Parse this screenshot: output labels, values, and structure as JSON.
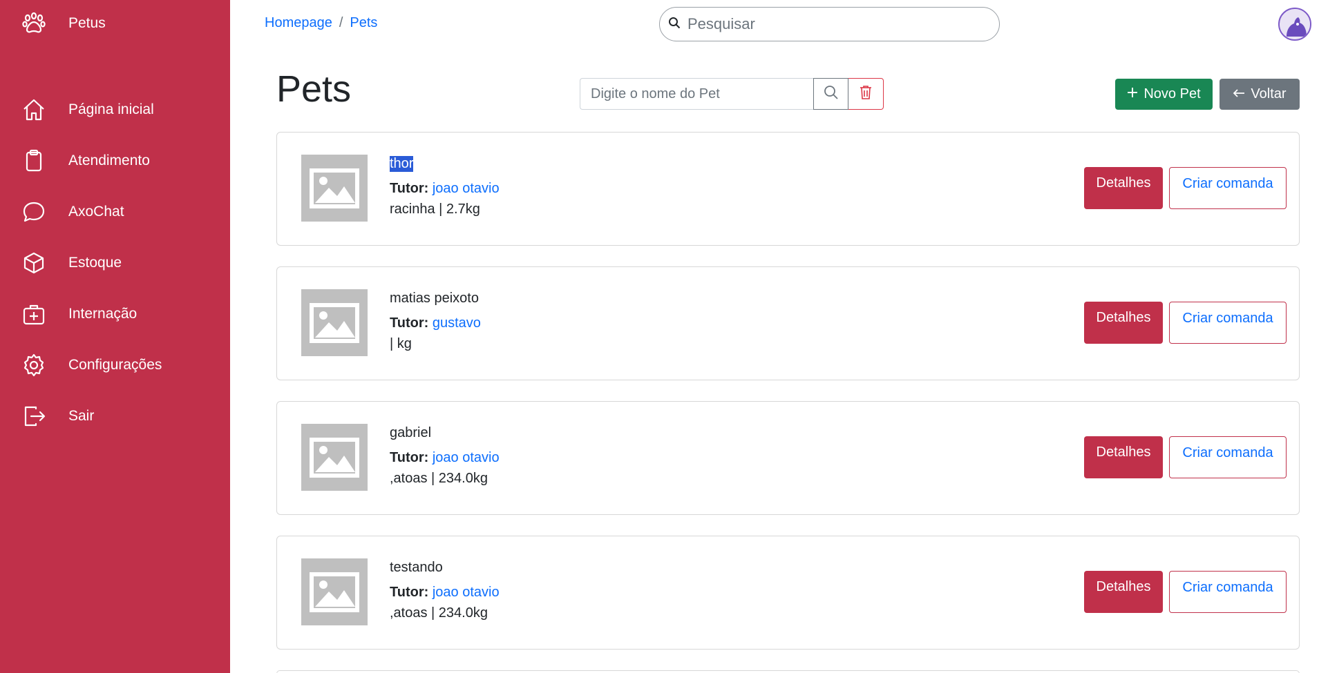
{
  "colors": {
    "sidebar": "#c0304a",
    "link": "#0d6efd",
    "success": "#198754",
    "secondary": "#6c757d",
    "danger": "#dc3545"
  },
  "sidebar": {
    "brand": {
      "label": "Petus",
      "icon": "paw-icon"
    },
    "items": [
      {
        "label": "Página inicial",
        "icon": "home-icon"
      },
      {
        "label": "Atendimento",
        "icon": "clipboard-icon"
      },
      {
        "label": "AxoChat",
        "icon": "chat-icon"
      },
      {
        "label": "Estoque",
        "icon": "box-icon"
      },
      {
        "label": "Internação",
        "icon": "medical-case-icon"
      },
      {
        "label": "Configurações",
        "icon": "gear-icon"
      },
      {
        "label": "Sair",
        "icon": "logout-icon"
      }
    ]
  },
  "header": {
    "breadcrumb": {
      "home": "Homepage",
      "separator": "/",
      "current": "Pets"
    },
    "search_placeholder": "Pesquisar"
  },
  "page": {
    "title": "Pets",
    "pet_search_placeholder": "Digite o nome do Pet",
    "new_button": "Novo Pet",
    "back_button": "Voltar"
  },
  "pets": [
    {
      "name": "thor",
      "tutor_label": "Tutor:",
      "tutor": "joao otavio",
      "info": "racinha | 2.7kg",
      "details": "Detalhes",
      "order": "Criar comanda"
    },
    {
      "name": "matias peixoto",
      "tutor_label": "Tutor:",
      "tutor": "gustavo",
      "info": "| kg",
      "details": "Detalhes",
      "order": "Criar comanda"
    },
    {
      "name": "gabriel",
      "tutor_label": "Tutor:",
      "tutor": "joao otavio",
      "info": ",atoas | 234.0kg",
      "details": "Detalhes",
      "order": "Criar comanda"
    },
    {
      "name": "testando",
      "tutor_label": "Tutor:",
      "tutor": "joao otavio",
      "info": ",atoas | 234.0kg",
      "details": "Detalhes",
      "order": "Criar comanda"
    }
  ]
}
